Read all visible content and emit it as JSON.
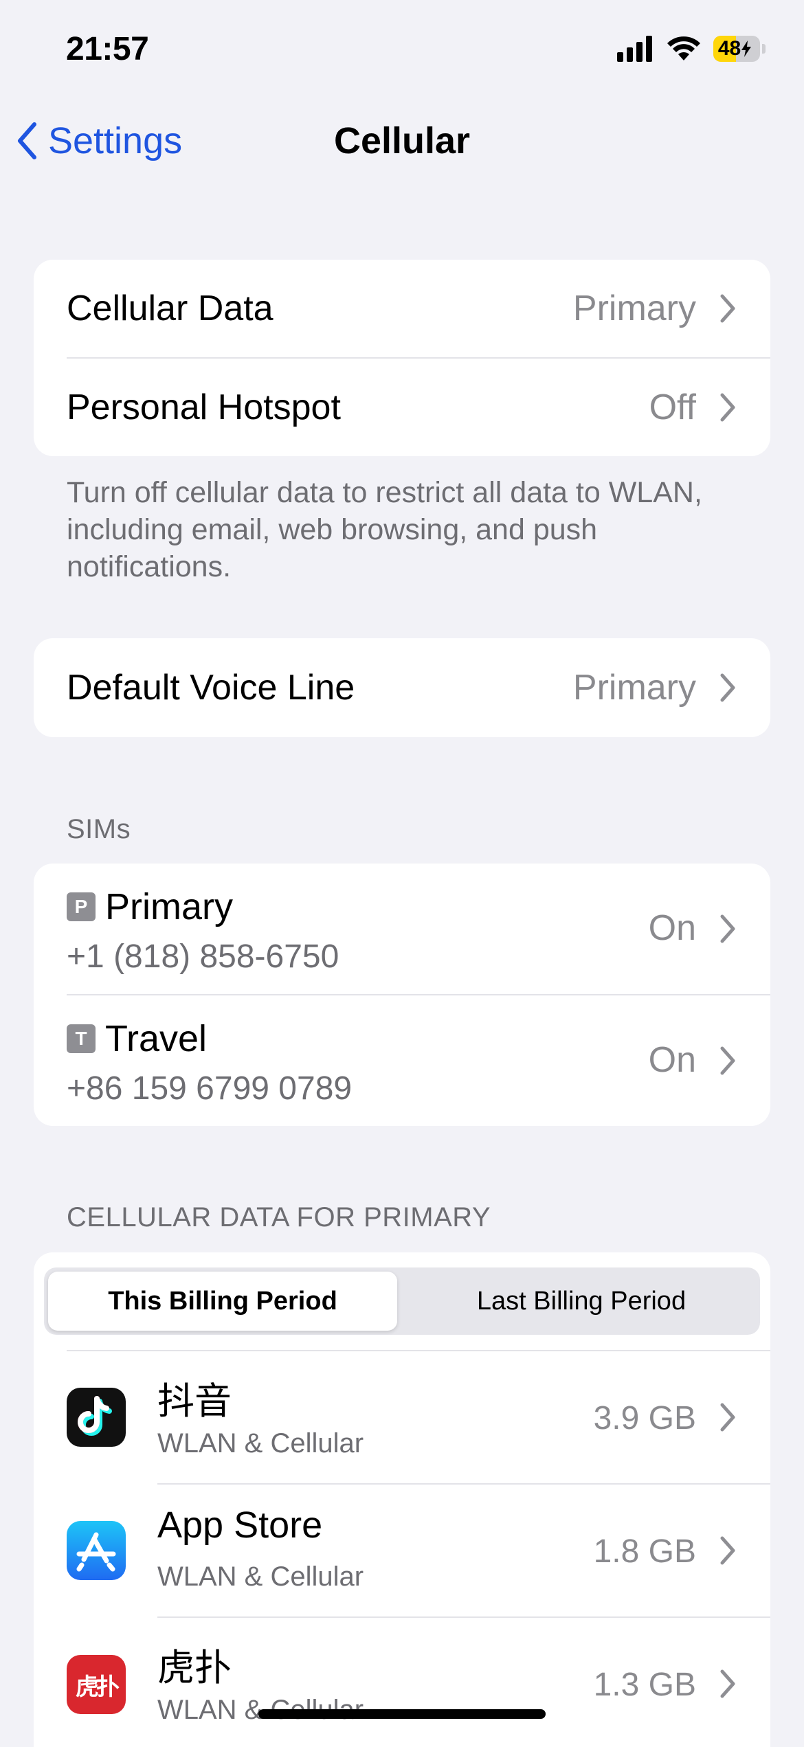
{
  "status_bar": {
    "time": "21:57",
    "battery_level": "48",
    "battery_fraction": 0.48,
    "battery_charging": true,
    "signal_icon": "cellular-signal-icon",
    "wifi_icon": "wifi-icon"
  },
  "nav": {
    "back_label": "Settings",
    "title": "Cellular"
  },
  "colors": {
    "accent": "#1f55e0",
    "background": "#f2f2f7",
    "battery_charging": "#ffd60a"
  },
  "group1": {
    "rows": [
      {
        "label": "Cellular Data",
        "value": "Primary"
      },
      {
        "label": "Personal Hotspot",
        "value": "Off"
      }
    ],
    "footer": "Turn off cellular data to restrict all data to WLAN, including email, web browsing, and push notifications."
  },
  "group2": {
    "rows": [
      {
        "label": "Default Voice Line",
        "value": "Primary"
      }
    ]
  },
  "sims": {
    "header": "SIMs",
    "items": [
      {
        "badge": "P",
        "name": "Primary",
        "number": "+1 (818) 858-6750",
        "status": "On"
      },
      {
        "badge": "T",
        "name": "Travel",
        "number": "+86 159 6799 0789",
        "status": "On"
      }
    ]
  },
  "usage": {
    "header": "CELLULAR DATA FOR PRIMARY",
    "segments": [
      "This Billing Period",
      "Last Billing Period"
    ],
    "selected_segment": "This Billing Period",
    "apps": [
      {
        "name": "抖音",
        "subtitle": "WLAN & Cellular",
        "size": "3.9 GB",
        "icon": "tiktok-icon"
      },
      {
        "name": "App Store",
        "subtitle": "WLAN & Cellular",
        "size": "1.8 GB",
        "icon": "app-store-icon"
      },
      {
        "name": "虎扑",
        "subtitle": "WLAN & Cellular",
        "size": "1.3 GB",
        "icon": "hupu-icon",
        "icon_text": "虎扑"
      }
    ]
  }
}
